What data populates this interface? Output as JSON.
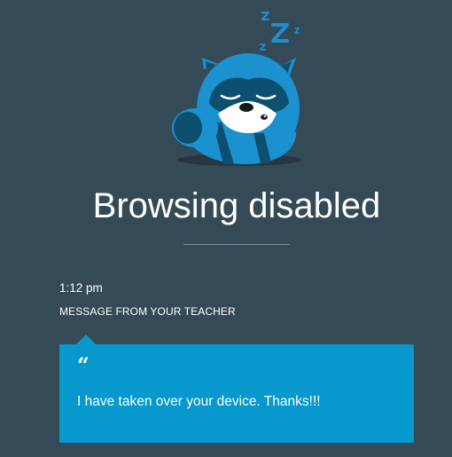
{
  "block_page": {
    "title": "Browsing disabled",
    "mascot_icon": "sleeping-raccoon-icon",
    "sleep_glyph": "Zzz"
  },
  "teacher_message": {
    "time": "1:12 pm",
    "heading": "MESSAGE FROM YOUR TEACHER",
    "quote_mark": "“",
    "text": "I have taken over your device. Thanks!!!"
  },
  "colors": {
    "background": "#344a56",
    "bubble": "#0798cd",
    "mascot_blue": "#1b91d0",
    "mascot_dark": "#0d4f6e"
  }
}
